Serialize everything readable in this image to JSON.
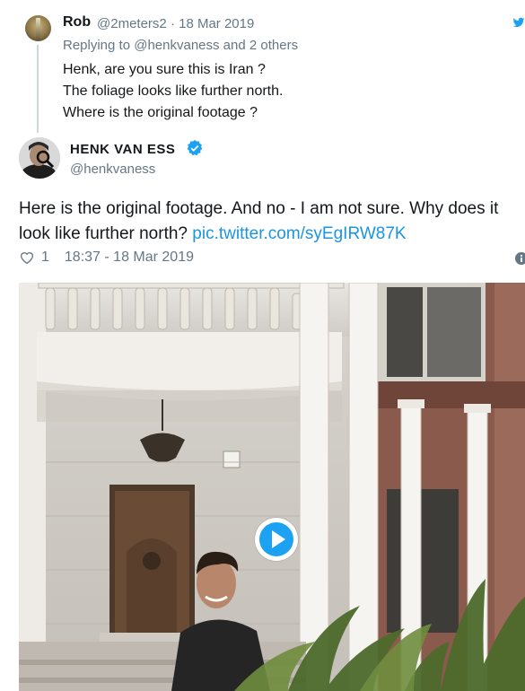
{
  "reply_tweet": {
    "name": "Rob",
    "handle": "@2meters2",
    "separator": "·",
    "date": "18 Mar 2019",
    "replying_prefix": "Replying to",
    "replying_to": "@henkvaness",
    "replying_suffix": "and 2 others",
    "lines": [
      "Henk, are you sure this is Iran ?",
      "The foliage looks like further north.",
      "Where is the original footage ?"
    ]
  },
  "main_tweet": {
    "name": "HENK VAN ESS",
    "handle": "@henkvaness",
    "text_line1": "Here is the original footage. And no - I am not sure. Why does it",
    "text_line2": "look like further north?",
    "link": "pic.twitter.com/syEgIRW87K",
    "likes": "1",
    "timestamp": "18:37 - 18 Mar 2019"
  },
  "colors": {
    "link": "#1b95e0",
    "muted": "#657786",
    "verified": "#1da1f2"
  },
  "icons": [
    "bird-icon",
    "verified-badge-icon",
    "heart-icon",
    "info-icon",
    "play-icon"
  ]
}
